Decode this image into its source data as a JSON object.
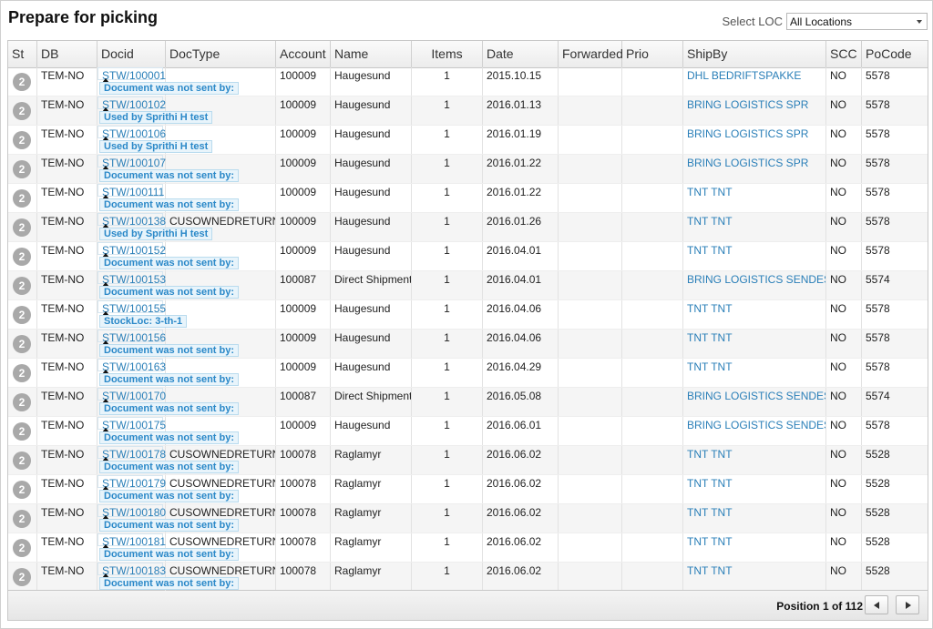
{
  "page": {
    "title": "Prepare for picking"
  },
  "location": {
    "label": "Select LOC",
    "selected": "All Locations"
  },
  "columns": [
    "St",
    "DB",
    "Docid",
    "DocType",
    "Account",
    "Name",
    "Items",
    "Date",
    "Forwarded",
    "Prio",
    "ShipBy",
    "SCC",
    "PoCode"
  ],
  "rows": [
    {
      "st": "2",
      "db": "TEM-NO",
      "docid": "STW/100001",
      "doctype": "",
      "account": "100009",
      "name": "Haugesund",
      "items": "1",
      "date": "2015.10.15",
      "forwarded": "",
      "prio": "",
      "shipby": "DHL BEDRIFTSPAKKE",
      "scc": "NO",
      "pocode": "5578",
      "note": "Document was not sent by:"
    },
    {
      "st": "2",
      "db": "TEM-NO",
      "docid": "STW/100102",
      "doctype": "",
      "account": "100009",
      "name": "Haugesund",
      "items": "1",
      "date": "2016.01.13",
      "forwarded": "",
      "prio": "",
      "shipby": "BRING LOGISTICS SPR",
      "scc": "NO",
      "pocode": "5578",
      "note": "Used by Sprithi H test"
    },
    {
      "st": "2",
      "db": "TEM-NO",
      "docid": "STW/100106",
      "doctype": "",
      "account": "100009",
      "name": "Haugesund",
      "items": "1",
      "date": "2016.01.19",
      "forwarded": "",
      "prio": "",
      "shipby": "BRING LOGISTICS SPR",
      "scc": "NO",
      "pocode": "5578",
      "note": "Used by Sprithi H test"
    },
    {
      "st": "2",
      "db": "TEM-NO",
      "docid": "STW/100107",
      "doctype": "",
      "account": "100009",
      "name": "Haugesund",
      "items": "1",
      "date": "2016.01.22",
      "forwarded": "",
      "prio": "",
      "shipby": "BRING LOGISTICS SPR",
      "scc": "NO",
      "pocode": "5578",
      "note": "Document was not sent by:"
    },
    {
      "st": "2",
      "db": "TEM-NO",
      "docid": "STW/100111",
      "doctype": "",
      "account": "100009",
      "name": "Haugesund",
      "items": "1",
      "date": "2016.01.22",
      "forwarded": "",
      "prio": "",
      "shipby": "TNT TNT",
      "scc": "NO",
      "pocode": "5578",
      "note": "Document was not sent by:"
    },
    {
      "st": "2",
      "db": "TEM-NO",
      "docid": "STW/100138",
      "doctype": "CUSOWNEDRETURN",
      "account": "100009",
      "name": "Haugesund",
      "items": "1",
      "date": "2016.01.26",
      "forwarded": "",
      "prio": "",
      "shipby": "TNT TNT",
      "scc": "NO",
      "pocode": "5578",
      "note": "Used by Sprithi H test"
    },
    {
      "st": "2",
      "db": "TEM-NO",
      "docid": "STW/100152",
      "doctype": "",
      "account": "100009",
      "name": "Haugesund",
      "items": "1",
      "date": "2016.04.01",
      "forwarded": "",
      "prio": "",
      "shipby": "TNT TNT",
      "scc": "NO",
      "pocode": "5578",
      "note": "Document was not sent by:"
    },
    {
      "st": "2",
      "db": "TEM-NO",
      "docid": "STW/100153",
      "doctype": "",
      "account": "100087",
      "name": "Direct Shipment",
      "items": "1",
      "date": "2016.04.01",
      "forwarded": "",
      "prio": "",
      "shipby": "BRING LOGISTICS SENDES",
      "scc": "NO",
      "pocode": "5574",
      "note": "Document was not sent by:"
    },
    {
      "st": "2",
      "db": "TEM-NO",
      "docid": "STW/100155",
      "doctype": "",
      "account": "100009",
      "name": "Haugesund",
      "items": "1",
      "date": "2016.04.06",
      "forwarded": "",
      "prio": "",
      "shipby": "TNT TNT",
      "scc": "NO",
      "pocode": "5578",
      "note": "StockLoc: 3-th-1"
    },
    {
      "st": "2",
      "db": "TEM-NO",
      "docid": "STW/100156",
      "doctype": "",
      "account": "100009",
      "name": "Haugesund",
      "items": "1",
      "date": "2016.04.06",
      "forwarded": "",
      "prio": "",
      "shipby": "TNT TNT",
      "scc": "NO",
      "pocode": "5578",
      "note": "Document was not sent by:"
    },
    {
      "st": "2",
      "db": "TEM-NO",
      "docid": "STW/100163",
      "doctype": "",
      "account": "100009",
      "name": "Haugesund",
      "items": "1",
      "date": "2016.04.29",
      "forwarded": "",
      "prio": "",
      "shipby": "TNT TNT",
      "scc": "NO",
      "pocode": "5578",
      "note": "Document was not sent by:"
    },
    {
      "st": "2",
      "db": "TEM-NO",
      "docid": "STW/100170",
      "doctype": "",
      "account": "100087",
      "name": "Direct Shipment",
      "items": "1",
      "date": "2016.05.08",
      "forwarded": "",
      "prio": "",
      "shipby": "BRING LOGISTICS SENDES",
      "scc": "NO",
      "pocode": "5574",
      "note": "Document was not sent by:"
    },
    {
      "st": "2",
      "db": "TEM-NO",
      "docid": "STW/100175",
      "doctype": "",
      "account": "100009",
      "name": "Haugesund",
      "items": "1",
      "date": "2016.06.01",
      "forwarded": "",
      "prio": "",
      "shipby": "BRING LOGISTICS SENDES",
      "scc": "NO",
      "pocode": "5578",
      "note": "Document was not sent by:"
    },
    {
      "st": "2",
      "db": "TEM-NO",
      "docid": "STW/100178",
      "doctype": "CUSOWNEDRETURN",
      "account": "100078",
      "name": "Raglamyr",
      "items": "1",
      "date": "2016.06.02",
      "forwarded": "",
      "prio": "",
      "shipby": "TNT TNT",
      "scc": "NO",
      "pocode": "5528",
      "note": "Document was not sent by:"
    },
    {
      "st": "2",
      "db": "TEM-NO",
      "docid": "STW/100179",
      "doctype": "CUSOWNEDRETURN",
      "account": "100078",
      "name": "Raglamyr",
      "items": "1",
      "date": "2016.06.02",
      "forwarded": "",
      "prio": "",
      "shipby": "TNT TNT",
      "scc": "NO",
      "pocode": "5528",
      "note": "Document was not sent by:"
    },
    {
      "st": "2",
      "db": "TEM-NO",
      "docid": "STW/100180",
      "doctype": "CUSOWNEDRETURN",
      "account": "100078",
      "name": "Raglamyr",
      "items": "1",
      "date": "2016.06.02",
      "forwarded": "",
      "prio": "",
      "shipby": "TNT TNT",
      "scc": "NO",
      "pocode": "5528",
      "note": "Document was not sent by:"
    },
    {
      "st": "2",
      "db": "TEM-NO",
      "docid": "STW/100181",
      "doctype": "CUSOWNEDRETURN",
      "account": "100078",
      "name": "Raglamyr",
      "items": "1",
      "date": "2016.06.02",
      "forwarded": "",
      "prio": "",
      "shipby": "TNT TNT",
      "scc": "NO",
      "pocode": "5528",
      "note": "Document was not sent by:"
    },
    {
      "st": "2",
      "db": "TEM-NO",
      "docid": "STW/100183",
      "doctype": "CUSOWNEDRETURN",
      "account": "100078",
      "name": "Raglamyr",
      "items": "1",
      "date": "2016.06.02",
      "forwarded": "",
      "prio": "",
      "shipby": "TNT TNT",
      "scc": "NO",
      "pocode": "5528",
      "note": "Document was not sent by:"
    }
  ],
  "footer": {
    "position_text": "Position 1 of 112"
  },
  "colors": {
    "link": "#2a7fb8",
    "badge": "#a9a9a9",
    "note_bg": "#e8f4fb",
    "note_text": "#2a88c8"
  },
  "icons": {
    "prev": "triangle-left-icon",
    "next": "triangle-right-icon",
    "dropdown": "chevron-down-icon",
    "row_marker": "triangle-up-icon"
  }
}
